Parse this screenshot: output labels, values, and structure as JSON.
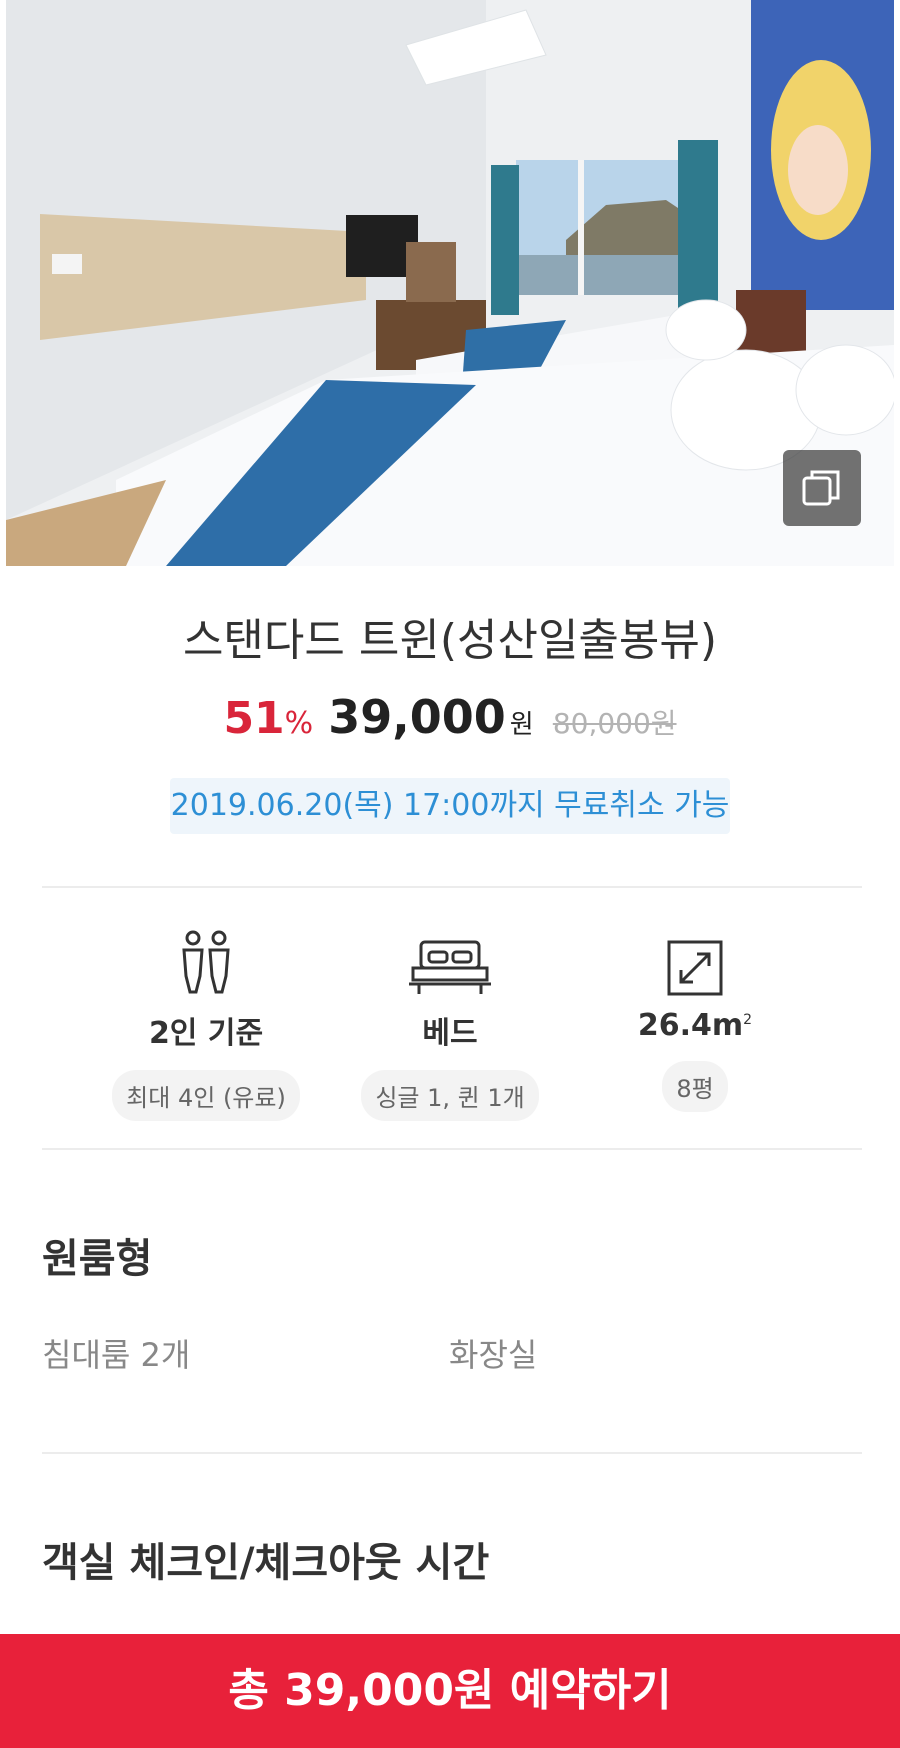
{
  "room": {
    "name": "스탠다드 트윈(성산일출봉뷰)",
    "discount": "51",
    "discount_unit": "%",
    "price": "39,000",
    "price_unit": "원",
    "original_price": "80,000원",
    "cancel_notice": "2019.06.20(목) 17:00까지 무료취소 가능"
  },
  "specs": [
    {
      "icon": "people-icon",
      "label": "2인 기준",
      "chip": "최대 4인 (유료)"
    },
    {
      "icon": "bed-icon",
      "label": "베드",
      "chip": "싱글 1, 퀸 1개"
    },
    {
      "icon": "expand-icon",
      "label": "26.4m",
      "label_sup": "2",
      "chip": "8평"
    }
  ],
  "room_type": {
    "title": "원룸형",
    "facilities": [
      "침대룸 2개",
      "화장실"
    ]
  },
  "checkin_section": {
    "title": "객실 체크인/체크아웃 시간"
  },
  "booking": {
    "button_label": "총 39,000원 예약하기"
  },
  "colors": {
    "accent": "#e8213a",
    "discount": "#d9253a",
    "info_blue": "#2d8fd5",
    "info_bg": "#eef5fb"
  }
}
